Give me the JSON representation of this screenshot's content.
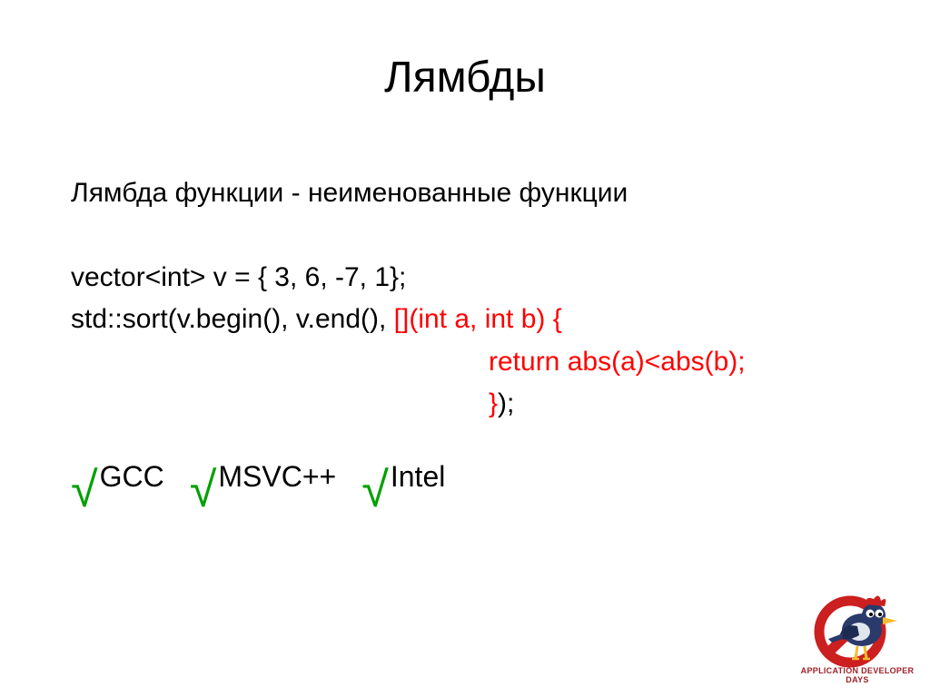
{
  "title": "Лямбды",
  "intro": "Лямбда функции - неименованные функции",
  "code": {
    "line1": "vector<int> v = { 3, 6, -7, 1};",
    "line2_black": "std::sort(v.begin(), v.end(), ",
    "line2_red": "[](int a, int b) {",
    "line3_red": "return abs(a)<abs(b);",
    "line4_red": "}",
    "line4_black": ");"
  },
  "compilers": {
    "gcc": "GCC",
    "msvc": "MSVC++",
    "intel": "Intel"
  },
  "logo_caption": "APPLICATION DEVELOPER DAYS"
}
